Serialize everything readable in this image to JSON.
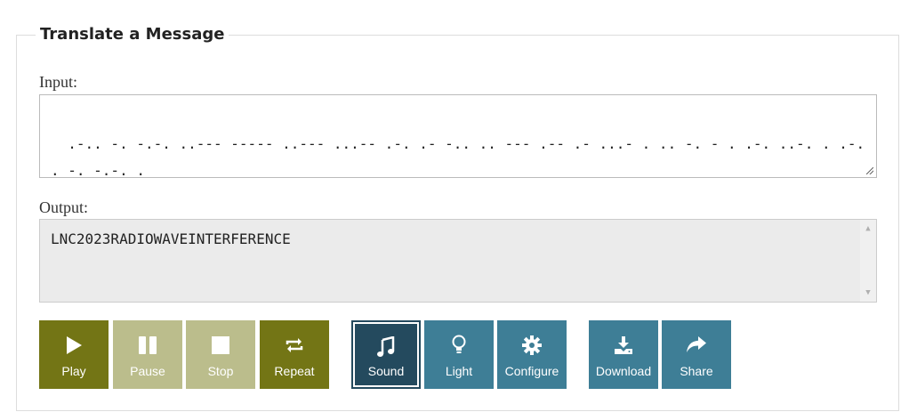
{
  "panel": {
    "legend": "Translate a Message",
    "input_label": "Input:",
    "input_value": ".-.. -. -.-. ..--- ----- ..--- ...-- .-. .- -.. .. --- .-- .- ...- . .. -. - . .-. ..-. . .-. . -. -.-. .",
    "output_label": "Output:",
    "output_value": "LNC2023RADIOWAVEINTERFERENCE"
  },
  "buttons": {
    "play": "Play",
    "pause": "Pause",
    "stop": "Stop",
    "repeat": "Repeat",
    "sound": "Sound",
    "light": "Light",
    "configure": "Configure",
    "download": "Download",
    "share": "Share"
  },
  "colors": {
    "olive": "#737515",
    "olive_disabled": "#bbbd8c",
    "teal": "#3e7e96",
    "selected": "#244a5e"
  },
  "icons": [
    "play-icon",
    "pause-icon",
    "stop-icon",
    "repeat-icon",
    "music-note-icon",
    "lightbulb-icon",
    "gear-icon",
    "download-icon",
    "share-icon"
  ]
}
